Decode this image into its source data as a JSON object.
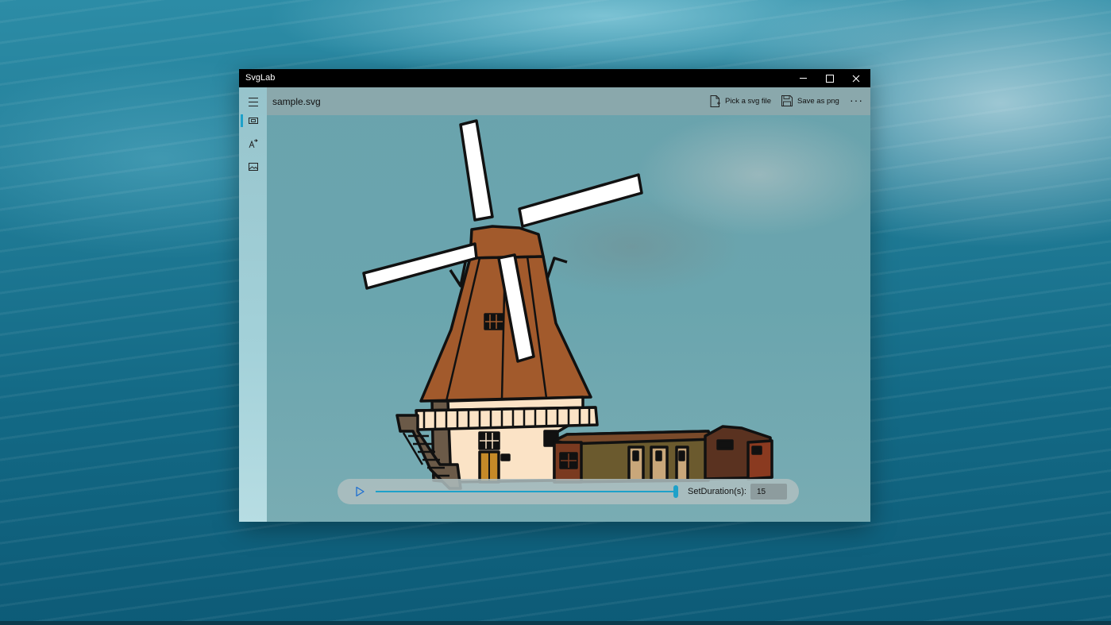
{
  "window": {
    "title": "SvgLab",
    "controls": [
      "minimize",
      "maximize",
      "close"
    ]
  },
  "nav": {
    "items": [
      {
        "name": "menu",
        "icon": "hamburger-icon"
      },
      {
        "name": "preview",
        "icon": "preview-icon",
        "active": true
      },
      {
        "name": "animate",
        "icon": "animate-icon"
      },
      {
        "name": "image",
        "icon": "image-icon"
      }
    ]
  },
  "commandbar": {
    "filename": "sample.svg",
    "pick_label": "Pick a svg file",
    "save_label": "Save as png",
    "more_label": "···"
  },
  "player": {
    "progress": 1.0,
    "duration_label": "SetDuration(s):",
    "duration_value": "15"
  },
  "colors": {
    "accent": "#1ea1c9",
    "roof": "#a25a2c",
    "wall": "#fbe3c6",
    "shed": "#7a4a2a"
  }
}
